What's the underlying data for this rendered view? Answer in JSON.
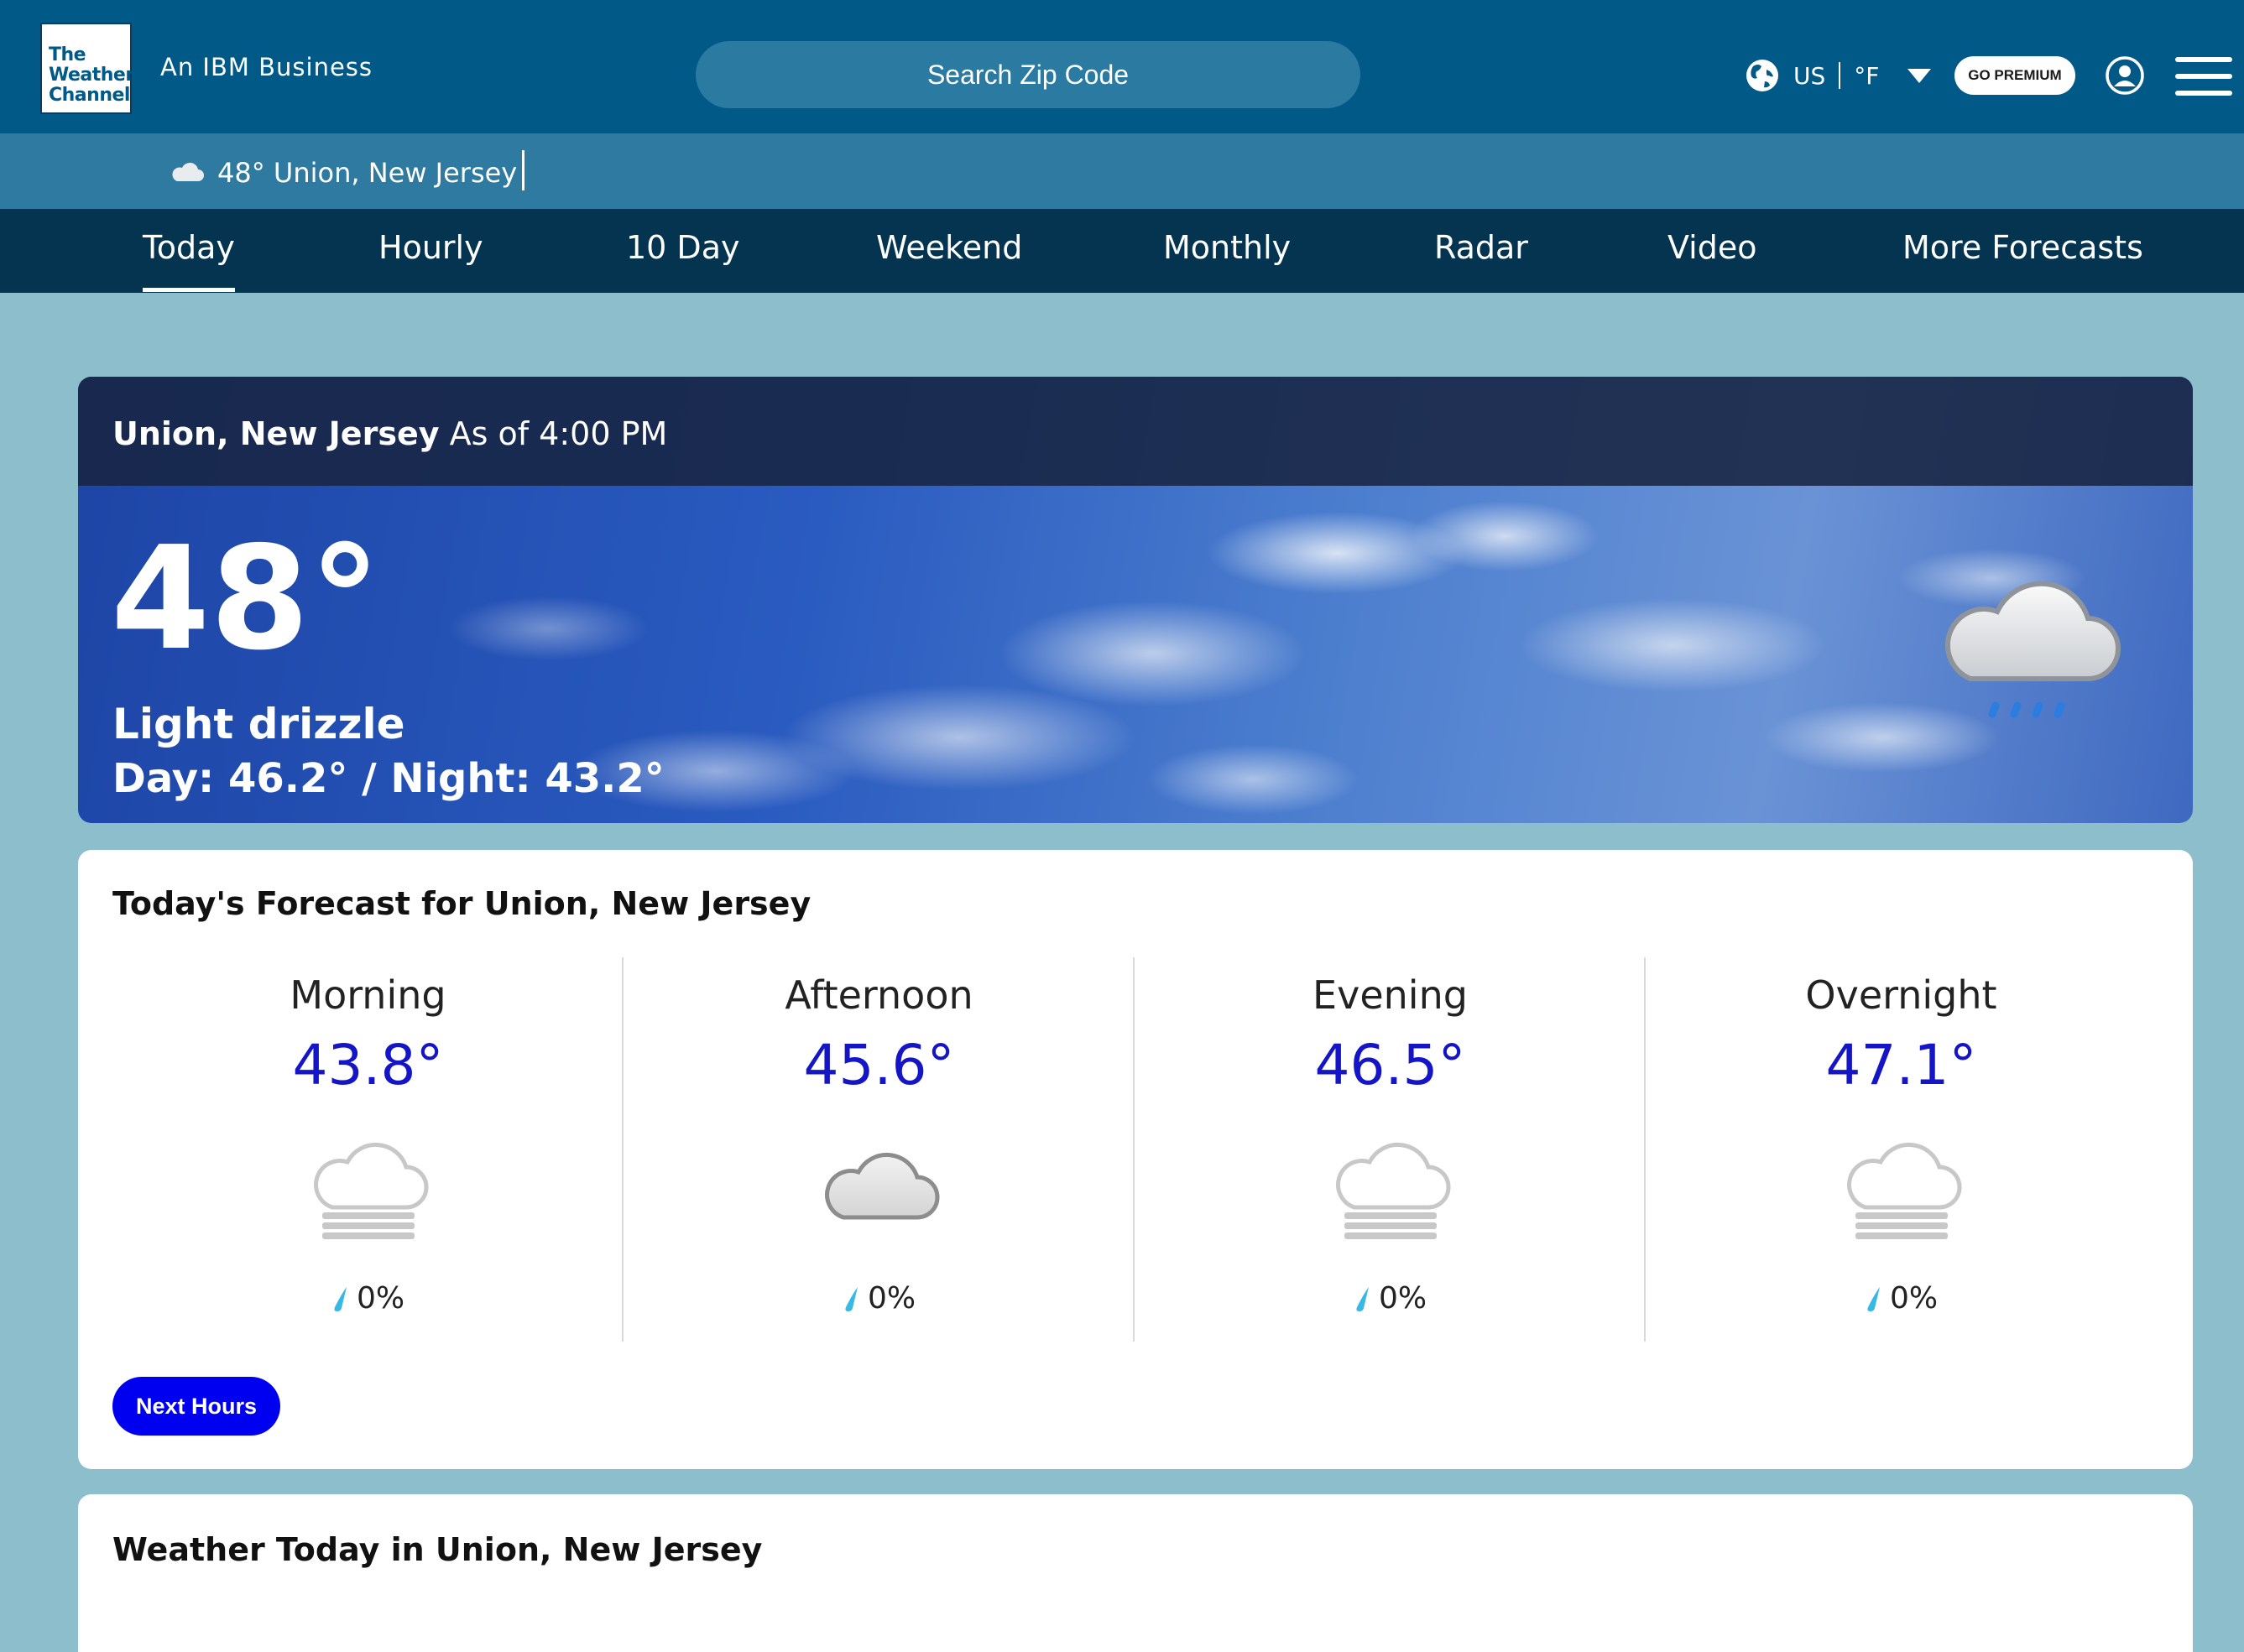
{
  "header": {
    "logo": {
      "line1": "The",
      "line2": "Weather",
      "line3": "Channel"
    },
    "tagline": "An IBM Business",
    "search_placeholder": "Search Zip Code",
    "region": "US",
    "unit": "°F",
    "premium_label": "GO PREMIUM",
    "icons": [
      "globe-icon",
      "chevron-down-icon",
      "account-icon",
      "hamburger-menu-icon"
    ]
  },
  "location_strip": {
    "text": "48° Union, New Jersey",
    "icon": "cloud-icon"
  },
  "nav": {
    "tabs": [
      {
        "label": "Today",
        "active": true
      },
      {
        "label": "Hourly",
        "active": false
      },
      {
        "label": "10 Day",
        "active": false
      },
      {
        "label": "Weekend",
        "active": false
      },
      {
        "label": "Monthly",
        "active": false
      },
      {
        "label": "Radar",
        "active": false
      },
      {
        "label": "Video",
        "active": false
      },
      {
        "label": "More Forecasts",
        "active": false
      }
    ]
  },
  "current": {
    "location": "Union, New Jersey",
    "as_of": "As of 4:00 PM",
    "temperature": "48°",
    "condition": "Light drizzle",
    "day_night": "Day: 46.2° / Night: 43.2°",
    "icon": "cloud-drizzle-icon"
  },
  "today_forecast": {
    "title": "Today's Forecast for Union, New Jersey",
    "periods": [
      {
        "name": "Morning",
        "temp": "43.8°",
        "icon": "fog-icon",
        "precip": "0%"
      },
      {
        "name": "Afternoon",
        "temp": "45.6°",
        "icon": "cloudy-icon",
        "precip": "0%"
      },
      {
        "name": "Evening",
        "temp": "46.5°",
        "icon": "fog-icon",
        "precip": "0%"
      },
      {
        "name": "Overnight",
        "temp": "47.1°",
        "icon": "fog-icon",
        "precip": "0%"
      }
    ],
    "button_label": "Next Hours"
  },
  "weather_today": {
    "title": "Weather Today in Union, New Jersey"
  },
  "colors": {
    "header_bg": "#005987",
    "strip_bg": "#2f7aa0",
    "nav_bg": "#053451",
    "page_bg": "#8cbfcb",
    "temp_blue": "#1515c8",
    "button_blue": "#0000f0"
  }
}
